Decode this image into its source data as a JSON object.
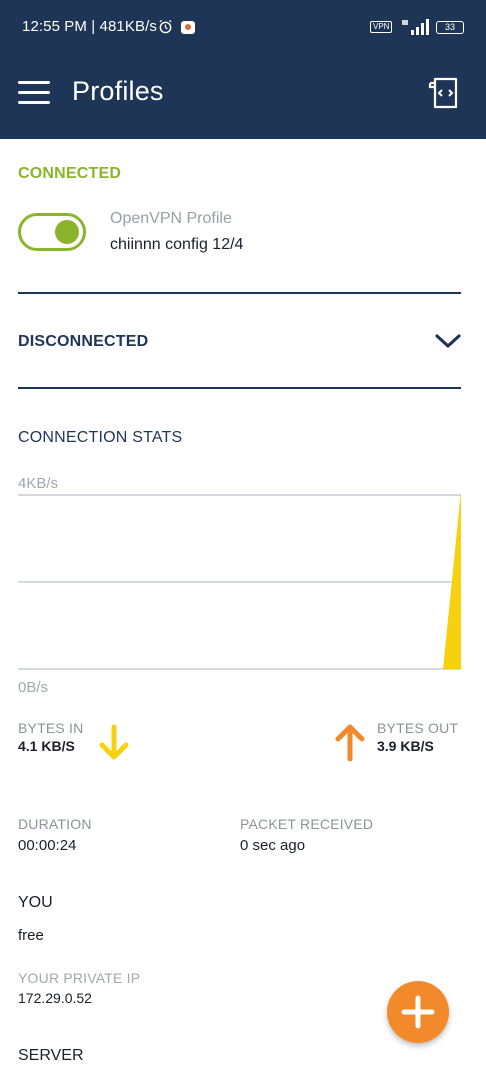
{
  "status_bar": {
    "text": "12:55 PM | 481KB/s",
    "vpn_badge": "VPN",
    "battery": "33",
    "icons": [
      "alarm-icon",
      "notification-icon",
      "signal-icon",
      "battery-icon"
    ]
  },
  "app_bar": {
    "title": "Profiles",
    "icons": [
      "menu-icon",
      "import-profile-icon"
    ],
    "color": "#1f3556"
  },
  "connected": {
    "label": "CONNECTED",
    "color": "#8ab52b",
    "toggle_on": true,
    "profile_type": "OpenVPN Profile",
    "profile_name": "chiinnn config 12/4"
  },
  "disconnected": {
    "label": "DISCONNECTED",
    "icon": "chevron-down-icon"
  },
  "stats": {
    "label": "CONNECTION STATS",
    "chart_data": {
      "type": "area",
      "ylabel_top": "4KB/s",
      "ylabel_bottom": "0B/s",
      "ylim": [
        0,
        4
      ],
      "grid": true,
      "series": [
        {
          "values": [
            0,
            0,
            0,
            0,
            0,
            0,
            0,
            0,
            0,
            0,
            0,
            0,
            0,
            0,
            0,
            0,
            0,
            0,
            0,
            0,
            4.1
          ],
          "color": "#f5d10f"
        }
      ]
    },
    "bytes_in": {
      "label": "BYTES IN",
      "value": "4.1 KB/S",
      "icon": "arrow-down-icon",
      "color": "#f5d10f"
    },
    "bytes_out": {
      "label": "BYTES OUT",
      "value": "3.9 KB/S",
      "icon": "arrow-up-icon",
      "color": "#f28a2c"
    },
    "duration": {
      "label": "DURATION",
      "value": "00:00:24"
    },
    "packet": {
      "label": "PACKET RECEIVED",
      "value": "0 sec ago"
    }
  },
  "you": {
    "label": "YOU",
    "value": "free",
    "ip_label": "YOUR PRIVATE IP",
    "ip_value": "172.29.0.52"
  },
  "server": {
    "label": "SERVER"
  },
  "fab": {
    "icon": "plus-icon",
    "color": "#f28a2c"
  }
}
